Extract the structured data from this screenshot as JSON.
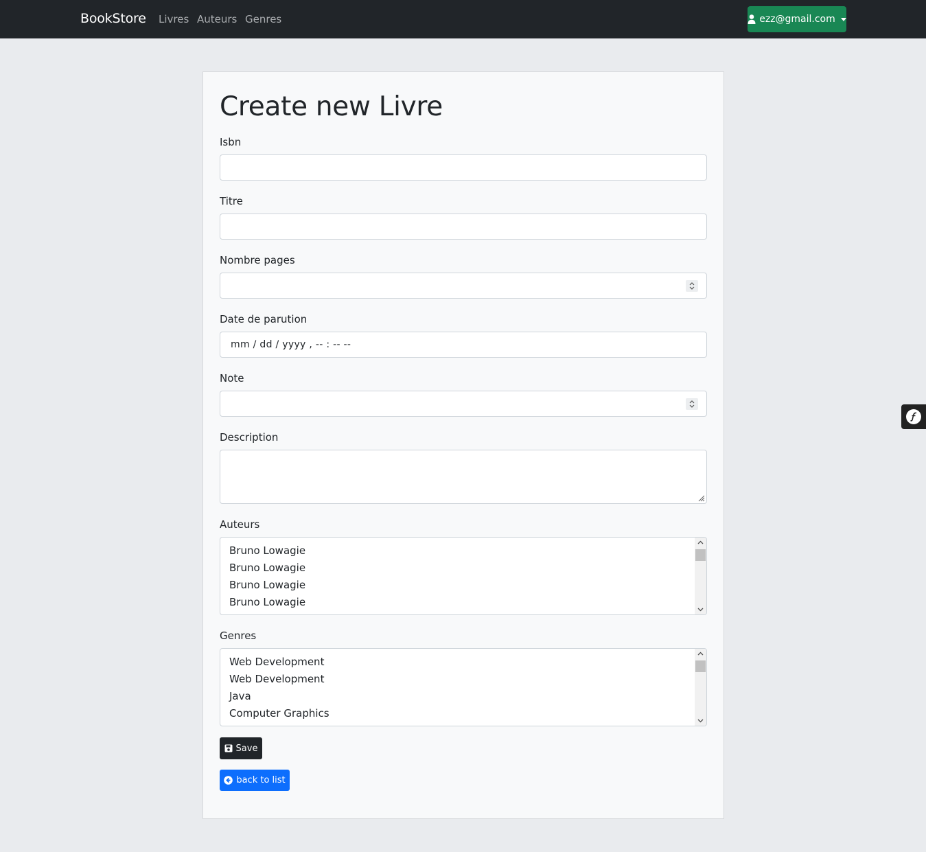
{
  "navbar": {
    "brand": "BookStore",
    "links": [
      "Livres",
      "Auteurs",
      "Genres"
    ],
    "user": "ezz@gmail.com"
  },
  "form": {
    "title": "Create new Livre",
    "isbn_label": "Isbn",
    "titre_label": "Titre",
    "pages_label": "Nombre pages",
    "date_label": "Date de parution",
    "date_placeholder": "mm / dd / yyyy ,  -- : --   --",
    "note_label": "Note",
    "description_label": "Description",
    "auteurs_label": "Auteurs",
    "auteurs_options": [
      "Bruno Lowagie",
      "Bruno Lowagie",
      "Bruno Lowagie",
      "Bruno Lowagie"
    ],
    "genres_label": "Genres",
    "genres_options": [
      "Web Development",
      "Web Development",
      "Java",
      "Computer Graphics"
    ],
    "save_label": "Save",
    "back_label": "back to list"
  },
  "colors": {
    "navbar": "#212529",
    "user_button": "#198754",
    "save_button": "#212529",
    "back_button": "#0d6efd",
    "background": "#e9ebee"
  },
  "icons": {
    "user": "user-icon",
    "caret": "caret-down-icon",
    "save": "floppy-disk-icon",
    "back": "arrow-circle-left-icon",
    "toolbar": "symfony-logo-icon"
  }
}
